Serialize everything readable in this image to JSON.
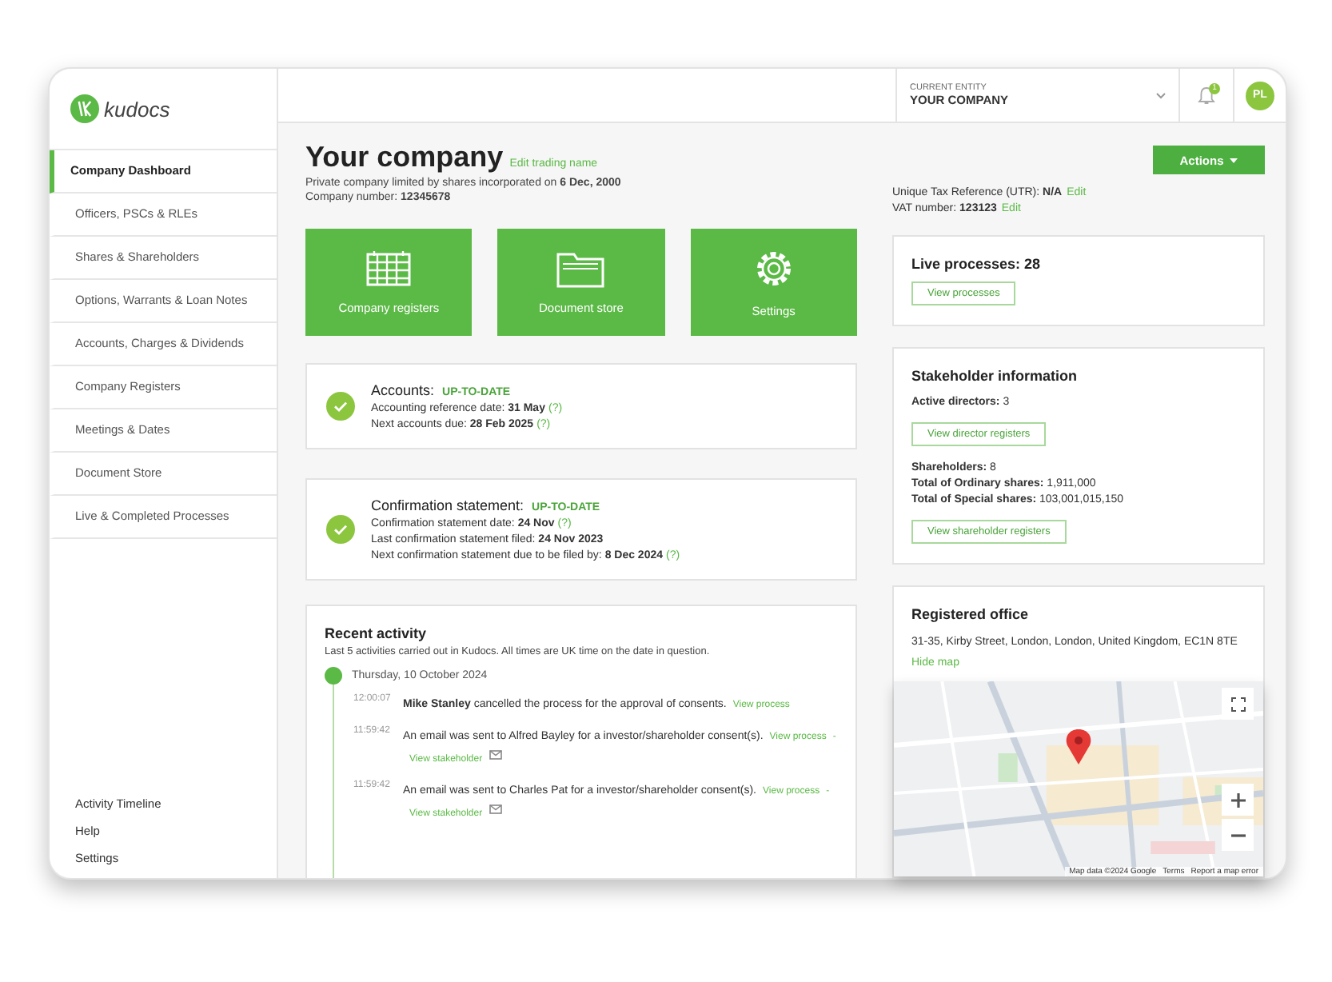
{
  "brand": {
    "name": "kudocs"
  },
  "entity": {
    "label": "CURRENT ENTITY",
    "name": "YOUR COMPANY"
  },
  "notifications": {
    "badge": "1"
  },
  "user": {
    "initials": "PL"
  },
  "sidebar": {
    "items": [
      {
        "label": "Company Dashboard",
        "selected": true
      },
      {
        "label": "Officers, PSCs & RLEs",
        "selected": false
      },
      {
        "label": "Shares & Shareholders",
        "selected": false
      },
      {
        "label": "Options, Warrants & Loan Notes",
        "selected": false
      },
      {
        "label": "Accounts, Charges & Dividends",
        "selected": false
      },
      {
        "label": "Company Registers",
        "selected": false
      },
      {
        "label": "Meetings & Dates",
        "selected": false
      },
      {
        "label": "Document Store",
        "selected": false
      },
      {
        "label": "Live & Completed Processes",
        "selected": false
      }
    ],
    "footer": [
      "Activity Timeline",
      "Help",
      "Settings"
    ]
  },
  "company": {
    "name": "Your company",
    "edit_link": "Edit trading name",
    "description": "Private company limited by shares incorporated on **6 Dec, 2000**",
    "number": "Company number: **12345678**"
  },
  "actions_button": "Actions",
  "tax": [
    {
      "text": "Unique Tax Reference (UTR): **N/A**",
      "link": "Edit"
    },
    {
      "text": "VAT number: **123123**",
      "link": "Edit"
    }
  ],
  "tiles": [
    {
      "label": "Company registers",
      "kind": "registers"
    },
    {
      "label": "Document store",
      "kind": "folder"
    },
    {
      "label": "Settings",
      "kind": "settings"
    }
  ],
  "compliance": [
    {
      "title": "Accounts:",
      "status": "UP-TO-DATE",
      "ok": true,
      "lines": [
        {
          "text": "Accounting reference date: **31 May**",
          "help": "(?)"
        },
        {
          "text": "Next accounts due: **28 Feb 2025**",
          "help": "(?)"
        }
      ]
    },
    {
      "title": "Confirmation statement:",
      "status": "UP-TO-DATE",
      "ok": true,
      "lines": [
        {
          "text": "Confirmation statement date: **24 Nov**",
          "help": "(?)"
        },
        {
          "text": "Last confirmation statement filed: **24 Nov 2023**"
        },
        {
          "text": "Next confirmation statement due to be filed by: **8 Dec 2024**",
          "help": "(?)"
        }
      ]
    }
  ],
  "activity": {
    "title": "Recent activity",
    "subtitle": "Last 5 activities carried out in Kudocs. All times are UK time on the date in question.",
    "link_separator": "-",
    "days": [
      {
        "date": "Thursday, 10 October 2024",
        "entries": [
          {
            "time": "12:00:07",
            "text": "**Mike Stanley** cancelled the process for the approval of consents.",
            "links": [
              "View process"
            ],
            "mail": false
          },
          {
            "time": "11:59:42",
            "text": "An email was sent to Alfred Bayley for a investor/shareholder consent(s).",
            "links": [
              "View process",
              "View stakeholder"
            ],
            "mail": true
          },
          {
            "time": "11:59:42",
            "text": "An email was sent to Charles Pat for a investor/shareholder consent(s).",
            "links": [
              "View process",
              "View stakeholder"
            ],
            "mail": true
          }
        ]
      }
    ]
  },
  "live": {
    "title": "Live processes: 28",
    "button": "View processes"
  },
  "stakeholders": {
    "title": "Stakeholder information",
    "groups": [
      {
        "lines": [
          "**Active directors:** 3"
        ],
        "button": "View director registers"
      },
      {
        "lines": [
          "**Shareholders:** 8",
          "**Total of Ordinary shares:** 1,911,000",
          "**Total of Special shares:** 103,001,015,150"
        ],
        "button": "View shareholder registers"
      }
    ]
  },
  "office": {
    "title": "Registered office",
    "address": "31-35, Kirby Street, London, London, United Kingdom, EC1N 8TE",
    "link": "Hide map",
    "map": {
      "kind": "picture",
      "attribution": [
        "Map data ©2024 Google",
        "Terms",
        "Report a map error"
      ]
    }
  }
}
